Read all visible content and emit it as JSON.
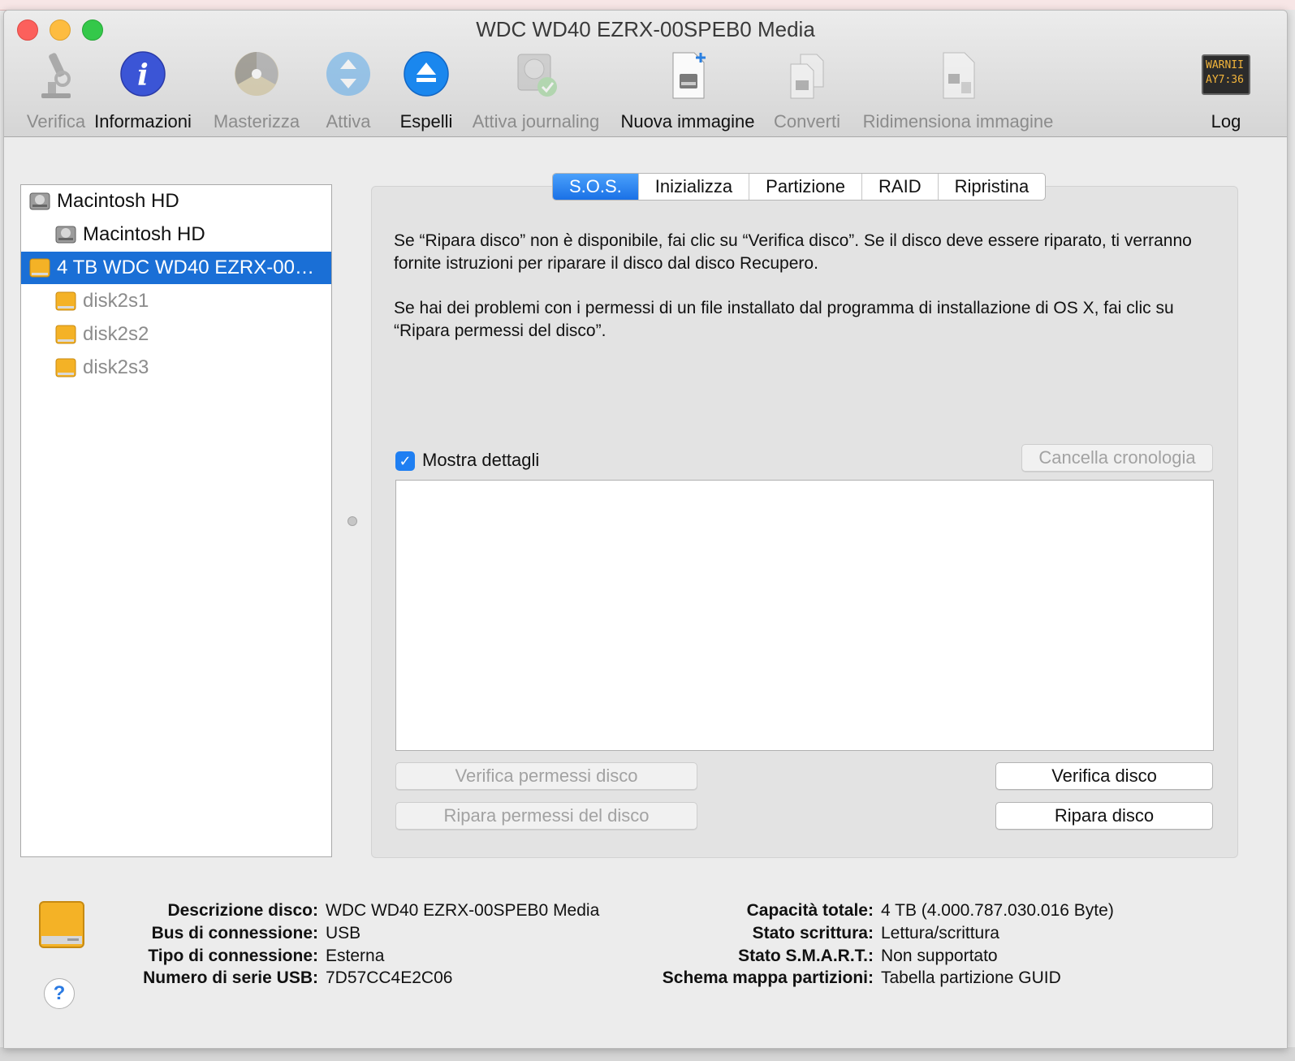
{
  "window": {
    "title": "WDC WD40 EZRX-00SPEB0 Media"
  },
  "toolbar": {
    "verifica": "Verifica",
    "informazioni": "Informazioni",
    "masterizza": "Masterizza",
    "attiva": "Attiva",
    "espelli": "Espelli",
    "attiva_journaling": "Attiva journaling",
    "nuova_immagine": "Nuova immagine",
    "converti": "Converti",
    "ridimensiona": "Ridimensiona immagine",
    "log": "Log",
    "log_icon_line1": "WARNII",
    "log_icon_line2": "AY7:36"
  },
  "sidebar": {
    "items": [
      {
        "label": "Macintosh HD",
        "icon": "internal-disk-icon",
        "level": 0,
        "state": "normal"
      },
      {
        "label": "Macintosh HD",
        "icon": "internal-volume-icon",
        "level": 1,
        "state": "normal"
      },
      {
        "label": "4 TB WDC WD40 EZRX-00…",
        "icon": "external-disk-icon",
        "level": 0,
        "state": "selected"
      },
      {
        "label": "disk2s1",
        "icon": "external-volume-icon",
        "level": 1,
        "state": "dim"
      },
      {
        "label": "disk2s2",
        "icon": "external-volume-icon",
        "level": 1,
        "state": "dim"
      },
      {
        "label": "disk2s3",
        "icon": "external-volume-icon",
        "level": 1,
        "state": "dim"
      }
    ]
  },
  "tabs": [
    "S.O.S.",
    "Inizializza",
    "Partizione",
    "RAID",
    "Ripristina"
  ],
  "sos": {
    "paragraph1": "Se “Ripara disco” non è disponibile, fai clic su “Verifica disco”. Se il disco deve essere riparato, ti verranno fornite istruzioni per riparare il disco dal disco Recupero.",
    "paragraph2": "Se hai dei problemi con i permessi di un file installato dal programma di installazione di OS X, fai clic su “Ripara permessi del disco”.",
    "show_details": "Mostra dettagli",
    "show_details_checked": true,
    "clear_history": "Cancella cronologia",
    "verify_permissions": "Verifica permessi disco",
    "repair_permissions": "Ripara permessi del disco",
    "verify_disk": "Verifica disco",
    "repair_disk": "Ripara disco"
  },
  "info": {
    "descrizione_label": "Descrizione disco",
    "descrizione_value": "WDC WD40 EZRX-00SPEB0 Media",
    "bus_label": "Bus di connessione",
    "bus_value": "USB",
    "tipo_label": "Tipo di connessione",
    "tipo_value": "Esterna",
    "serie_label": "Numero di serie USB",
    "serie_value": "7D57CC4E2C06",
    "capacita_label": "Capacità totale",
    "capacita_value": "4 TB (4.000.787.030.016 Byte)",
    "scrittura_label": "Stato scrittura",
    "scrittura_value": "Lettura/scrittura",
    "smart_label": "Stato S.M.A.R.T.",
    "smart_value": "Non supportato",
    "schema_label": "Schema mappa partizioni",
    "schema_value": "Tabella partizione GUID",
    "help": "?"
  },
  "colors": {
    "selection": "#1a6fd6",
    "tab_active": "#2a7ff0",
    "drive_orange": "#f4b226"
  }
}
